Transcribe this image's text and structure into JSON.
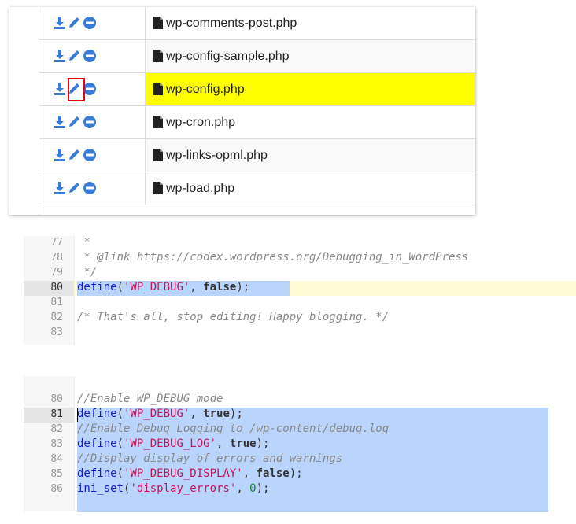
{
  "top_strip": {
    "prefix": "                  wp-config.php (partly cut off)",
    "highlight": ""
  },
  "file_manager": {
    "rows": [
      {
        "name": "wp-comments-post.php",
        "selected": false
      },
      {
        "name": "wp-config-sample.php",
        "selected": false
      },
      {
        "name": "wp-config.php",
        "selected": true
      },
      {
        "name": "wp-cron.php",
        "selected": false
      },
      {
        "name": "wp-links-opml.php",
        "selected": false
      },
      {
        "name": "wp-load.php",
        "selected": false
      }
    ],
    "icons": {
      "download": "download-icon",
      "edit": "pencil-icon",
      "delete": "minus-circle-icon",
      "file": "file-icon"
    },
    "colors": {
      "action_blue": "#3a7bd5",
      "highlight": "#ffff00",
      "marker_red": "#e8000b"
    }
  },
  "editor1": {
    "lines": [
      {
        "num": "77",
        "text": " *"
      },
      {
        "num": "78",
        "text": " * @link https://codex.wordpress.org/Debugging_in_WordPress"
      },
      {
        "num": "79",
        "text": " */"
      },
      {
        "num": "80",
        "text_fn": "define",
        "text_open": "(",
        "text_str": "'WP_DEBUG'",
        "text_mid": ", ",
        "text_val": "false",
        "text_close": ");"
      },
      {
        "num": "81",
        "text": ""
      },
      {
        "num": "82",
        "text": "/* That's all, stop editing! Happy blogging. */"
      },
      {
        "num": "83",
        "text": ""
      }
    ]
  },
  "editor2": {
    "lines": [
      {
        "num": "80",
        "comment": "//Enable WP_DEBUG mode"
      },
      {
        "num": "81",
        "fn": "define",
        "str": "'WP_DEBUG'",
        "val": "true",
        "close": ");"
      },
      {
        "num": "82",
        "comment": "//Enable Debug Logging to /wp-content/debug.log"
      },
      {
        "num": "83",
        "fn": "define",
        "str": "'WP_DEBUG_LOG'",
        "val": "true",
        "close": ");"
      },
      {
        "num": "84",
        "comment": "//Display display of errors and warnings"
      },
      {
        "num": "85",
        "fn": "define",
        "str": "'WP_DEBUG_DISPLAY'",
        "val": "false",
        "close": ");"
      },
      {
        "num": "86",
        "fn": "ini_set",
        "str": "'display_errors'",
        "num_val": "0",
        "close": ");"
      }
    ]
  }
}
